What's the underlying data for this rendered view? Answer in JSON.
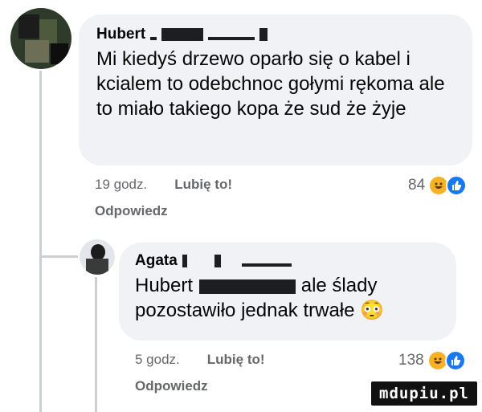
{
  "comments": [
    {
      "author": "Hubert",
      "text": "Mi kiedyś drzewo oparło się o kabel i kcialem to odebchnoc gołymi rękoma  ale to miało takiego kopa że sud że żyje",
      "time": "19 godz.",
      "like_label": "Lubię to!",
      "reply_label": "Odpowiedz",
      "reaction_count": "84",
      "reaction_icons": [
        "haha-icon",
        "like-icon"
      ]
    },
    {
      "author": "Agata",
      "mention": "Hubert",
      "text": " ale ślady pozostawiło jednak trwałe",
      "emoji": "😳",
      "time": "5 godz.",
      "like_label": "Lubię to!",
      "reply_label": "Odpowiedz",
      "reaction_count": "138",
      "reaction_icons": [
        "haha-icon",
        "like-icon"
      ]
    }
  ],
  "watermark": "mdupiu.pl",
  "colors": {
    "bubble": "#f0f2f5",
    "meta": "#65676b",
    "like_blue": "#1877f2",
    "haha_yellow": "#f7b125"
  }
}
